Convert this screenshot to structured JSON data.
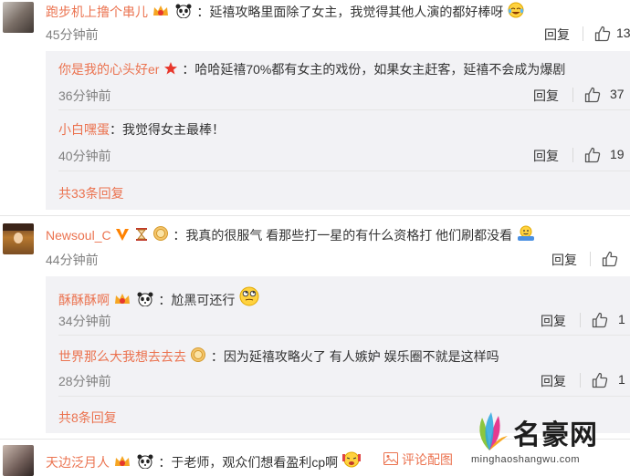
{
  "comments": [
    {
      "name": "跑步机上撸个串儿",
      "text": "：延禧攻略里面除了女主，我觉得其他人演的都好棒呀",
      "time": "45分钟前",
      "reply": "回复",
      "likes": "13",
      "replies": [
        {
          "name": "你是我的心头好er",
          "text": "：哈哈延禧70%都有女主的戏份，如果女主赶客，延禧不会成为爆剧",
          "time": "36分钟前",
          "reply": "回复",
          "likes": "37"
        },
        {
          "name": "小白嘿蛋",
          "text": "：我觉得女主最棒！",
          "time": "40分钟前",
          "reply": "回复",
          "likes": "19"
        }
      ],
      "more": "共33条回复"
    },
    {
      "name": "Newsoul_C",
      "text": "：我真的很服气 看那些打一星的有什么资格打 他们刷都没看",
      "time": "44分钟前",
      "reply": "回复",
      "likes": "",
      "replies": [
        {
          "name": "酥酥酥啊",
          "text": "：尬黑可还行",
          "time": "34分钟前",
          "reply": "回复",
          "likes": "1"
        },
        {
          "name": "世界那么大我想去去去",
          "text": "：因为延禧攻略火了 有人嫉妒 娱乐圈不就是这样吗",
          "time": "28分钟前",
          "reply": "回复",
          "likes": "1"
        }
      ],
      "more": "共8条回复"
    },
    {
      "name": "天边泛月人",
      "text": "：于老师，观众们想看盈利cp啊",
      "comment_link": "评论配图"
    }
  ],
  "watermark": {
    "brand": "名豪网",
    "url": "minghaoshangwu.com"
  },
  "colors": {
    "name": "#eb7350",
    "sub_bg": "#f2f2f5",
    "vip": "#ff8200"
  }
}
